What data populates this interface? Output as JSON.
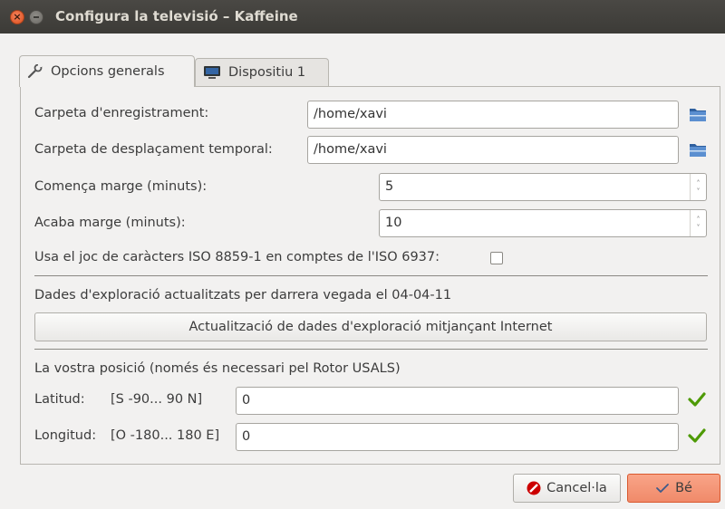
{
  "window": {
    "title": "Configura la televisió – Kaffeine"
  },
  "tabs": [
    {
      "label": "Opcions generals",
      "icon": "wrench-icon",
      "active": true
    },
    {
      "label": "Dispositiu 1",
      "icon": "monitor-icon",
      "active": false
    }
  ],
  "form": {
    "recording_folder_label": "Carpeta d'enregistrament:",
    "recording_folder_value": "/home/xavi",
    "timeshift_folder_label": "Carpeta de desplaçament temporal:",
    "timeshift_folder_value": "/home/xavi",
    "begin_margin_label": "Comença marge (minuts):",
    "begin_margin_value": "5",
    "end_margin_label": "Acaba marge (minuts):",
    "end_margin_value": "10",
    "iso_checkbox_label": "Usa el joc de caràcters ISO 8859-1 en comptes de l'ISO 6937:",
    "iso_checkbox_checked": false,
    "scan_data_text": "Dades d'exploració actualitzats per darrera vegada el 04-04-11",
    "update_button_label": "Actualització de dades d'exploració mitjançant Internet",
    "position_heading": "La vostra posició (només és necessari pel Rotor USALS)",
    "latitude_label": "Latitud:",
    "latitude_range": "[S -90... 90 N]",
    "latitude_value": "0",
    "longitude_label": "Longitud:",
    "longitude_range": "[O -180... 180 E]",
    "longitude_value": "0"
  },
  "buttons": {
    "cancel_label": "Cancel·la",
    "ok_label": "Bé"
  },
  "colors": {
    "titlebar": "#3c3b37",
    "ok_button": "#f08a6a",
    "valid_check": "#4e9a06",
    "folder_icon": "#3465a4"
  }
}
